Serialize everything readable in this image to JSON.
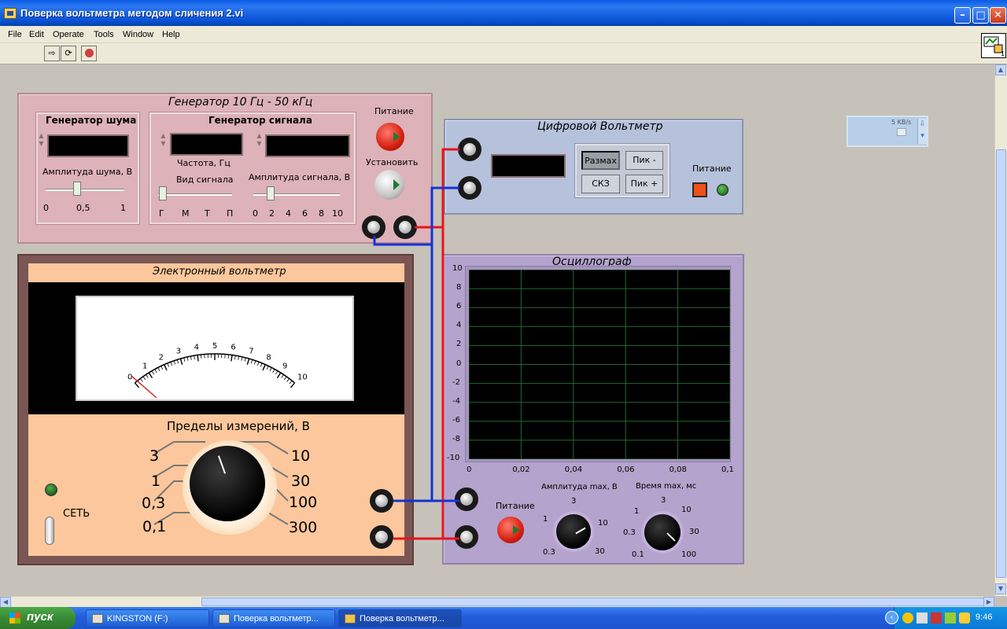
{
  "window": {
    "title": "Поверка вольтметра методом сличения 2.vi"
  },
  "menu": [
    "File",
    "Edit",
    "Operate",
    "Tools",
    "Window",
    "Help"
  ],
  "generator": {
    "title": "Генератор 10 Гц - 50 кГц",
    "noise_group": "Генератор шума",
    "noise_amp_label": "Амплитуда шума, В",
    "noise_ticks": [
      "0",
      "0,5",
      "1"
    ],
    "noise_level": 0.4,
    "signal_group": "Генератор сигнала",
    "freq_label": "Частота, Гц",
    "wave_label": "Вид сигнала",
    "wave_ticks": [
      "Г",
      "М",
      "Т",
      "П"
    ],
    "amp_label": "Амплитуда сигнала, В",
    "amp_ticks": [
      "0",
      "2",
      "4",
      "6",
      "8",
      "10"
    ],
    "amp_level": 2,
    "power_label": "Питание",
    "set_label": "Установить"
  },
  "dvm": {
    "title": "Цифровой Вольтметр",
    "btn_range": "Размах",
    "btn_peak_minus": "Пик -",
    "btn_rms": "СКЗ",
    "btn_peak_plus": "Пик +",
    "power_label": "Питание"
  },
  "ev": {
    "title": "Электронный вольтметр",
    "scale": [
      "0",
      "1",
      "2",
      "3",
      "4",
      "5",
      "6",
      "7",
      "8",
      "9",
      "10"
    ],
    "needle_value": 0,
    "limits_title": "Пределы измерений, В",
    "left_ranges": [
      "3",
      "1",
      "0,3",
      "0,1"
    ],
    "right_ranges": [
      "10",
      "30",
      "100",
      "300"
    ],
    "mains_label": "СЕТЬ"
  },
  "osc": {
    "title": "Осциллограф",
    "y_ticks": [
      "10",
      "8",
      "6",
      "4",
      "2",
      "0",
      "-2",
      "-4",
      "-6",
      "-8",
      "-10"
    ],
    "x_ticks": [
      "0",
      "0,02",
      "0,04",
      "0,06",
      "0,08",
      "0,1"
    ],
    "power_label": "Питание",
    "amp_knob_label": "Амплитуда max, В",
    "amp_knob_ticks": [
      "3",
      "1",
      "10",
      "0.3",
      "30"
    ],
    "time_knob_label": "Время max, мс",
    "time_knob_ticks": [
      "3",
      "1",
      "10",
      "0.3",
      "30",
      "0.1",
      "100"
    ]
  },
  "net_widget": {
    "speed": "5 KB/s"
  },
  "taskbar": {
    "start": "пуск",
    "tasks": [
      "KINGSTON (F:)",
      "Поверка вольтметр...",
      "Поверка вольтметр..."
    ],
    "clock": "9:46"
  },
  "colors": {
    "wire_red": "#e8141c",
    "wire_blue": "#1433d6",
    "grid": "#1f6b2e"
  }
}
